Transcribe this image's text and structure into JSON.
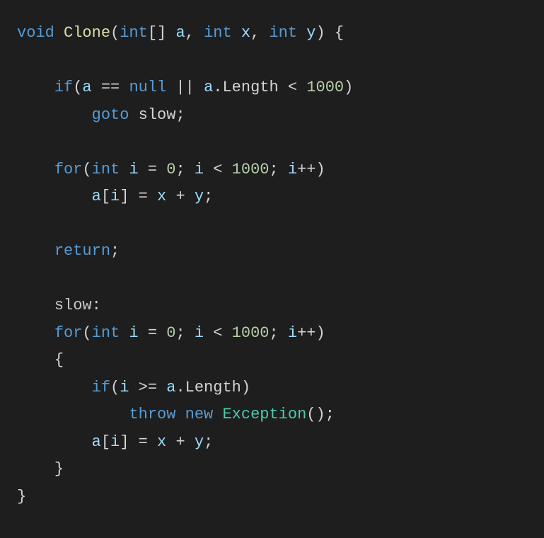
{
  "code": {
    "line1": {
      "void": "void",
      "fnName": "Clone",
      "lparen": "(",
      "int1": "int",
      "brackets": "[]",
      "sp1": " ",
      "a": "a",
      "comma1": ", ",
      "int2": "int",
      "sp2": " ",
      "x": "x",
      "comma2": ", ",
      "int3": "int",
      "sp3": " ",
      "y": "y",
      "rparen": ")",
      "sp4": " ",
      "lbrace": "{"
    },
    "line3": {
      "indent": "    ",
      "if": "if",
      "lparen": "(",
      "a": "a",
      "eq": " == ",
      "null": "null",
      "or": " || ",
      "a2": "a",
      "dot": ".",
      "length": "Length",
      "lt": " < ",
      "thousand": "1000",
      "rparen": ")"
    },
    "line4": {
      "indent": "        ",
      "goto": "goto",
      "sp": " ",
      "slow": "slow",
      "semi": ";"
    },
    "line6": {
      "indent": "    ",
      "for": "for",
      "lparen": "(",
      "int": "int",
      "sp": " ",
      "i": "i",
      "eq": " = ",
      "zero": "0",
      "semi1": "; ",
      "i2": "i",
      "lt": " < ",
      "thousand": "1000",
      "semi2": "; ",
      "i3": "i",
      "inc": "++",
      "rparen": ")"
    },
    "line7": {
      "indent": "        ",
      "a": "a",
      "lbracket": "[",
      "i": "i",
      "rbracket": "]",
      "eq": " = ",
      "x": "x",
      "plus": " + ",
      "y": "y",
      "semi": ";"
    },
    "line9": {
      "indent": "    ",
      "return": "return",
      "semi": ";"
    },
    "line11": {
      "indent": "    ",
      "slow": "slow",
      "colon": ":"
    },
    "line12": {
      "indent": "    ",
      "for": "for",
      "lparen": "(",
      "int": "int",
      "sp": " ",
      "i": "i",
      "eq": " = ",
      "zero": "0",
      "semi1": "; ",
      "i2": "i",
      "lt": " < ",
      "thousand": "1000",
      "semi2": "; ",
      "i3": "i",
      "inc": "++",
      "rparen": ")"
    },
    "line13": {
      "indent": "    ",
      "lbrace": "{"
    },
    "line14": {
      "indent": "        ",
      "if": "if",
      "lparen": "(",
      "i": "i",
      "gte": " >= ",
      "a": "a",
      "dot": ".",
      "length": "Length",
      "rparen": ")"
    },
    "line15": {
      "indent": "            ",
      "throw": "throw",
      "sp1": " ",
      "new": "new",
      "sp2": " ",
      "exception": "Exception",
      "parens": "()",
      "semi": ";"
    },
    "line16": {
      "indent": "        ",
      "a": "a",
      "lbracket": "[",
      "i": "i",
      "rbracket": "]",
      "eq": " = ",
      "x": "x",
      "plus": " + ",
      "y": "y",
      "semi": ";"
    },
    "line17": {
      "indent": "    ",
      "rbrace": "}"
    },
    "line18": {
      "rbrace": "}"
    }
  }
}
